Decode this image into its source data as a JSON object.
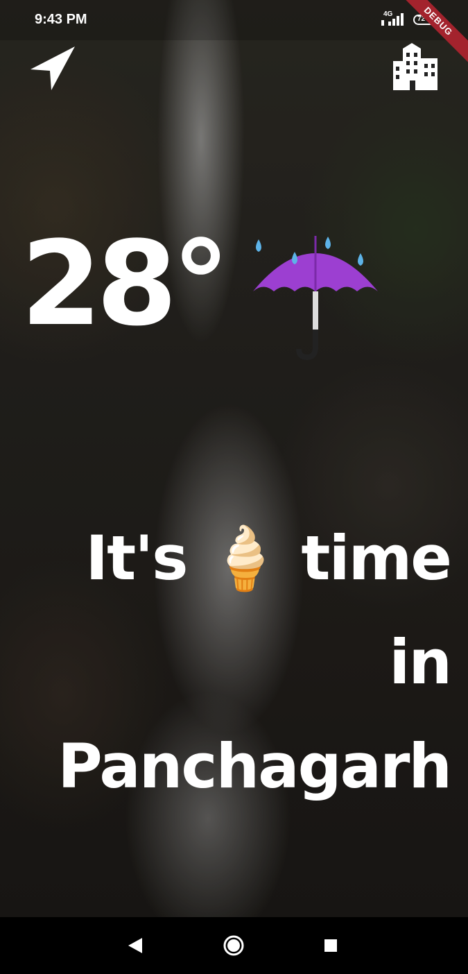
{
  "status_bar": {
    "time": "9:43 PM",
    "network": "4G",
    "battery": "72",
    "debug_label": "DEBUG"
  },
  "header": {
    "left_icon": "navigation-arrow-icon",
    "right_icon": "city-building-icon"
  },
  "weather": {
    "temperature": "28°",
    "condition_icon": "umbrella-rain-icon"
  },
  "message": {
    "text": "It's 🍦 time in Panchagarh"
  },
  "navigation_bar": {
    "back_icon": "back-triangle-icon",
    "home_icon": "home-circle-icon",
    "recents_icon": "recents-square-icon"
  },
  "colors": {
    "text": "#ffffff",
    "umbrella": "#9c3fd1",
    "raindrop": "#5db3e8",
    "debug_ribbon": "#a3232d"
  }
}
